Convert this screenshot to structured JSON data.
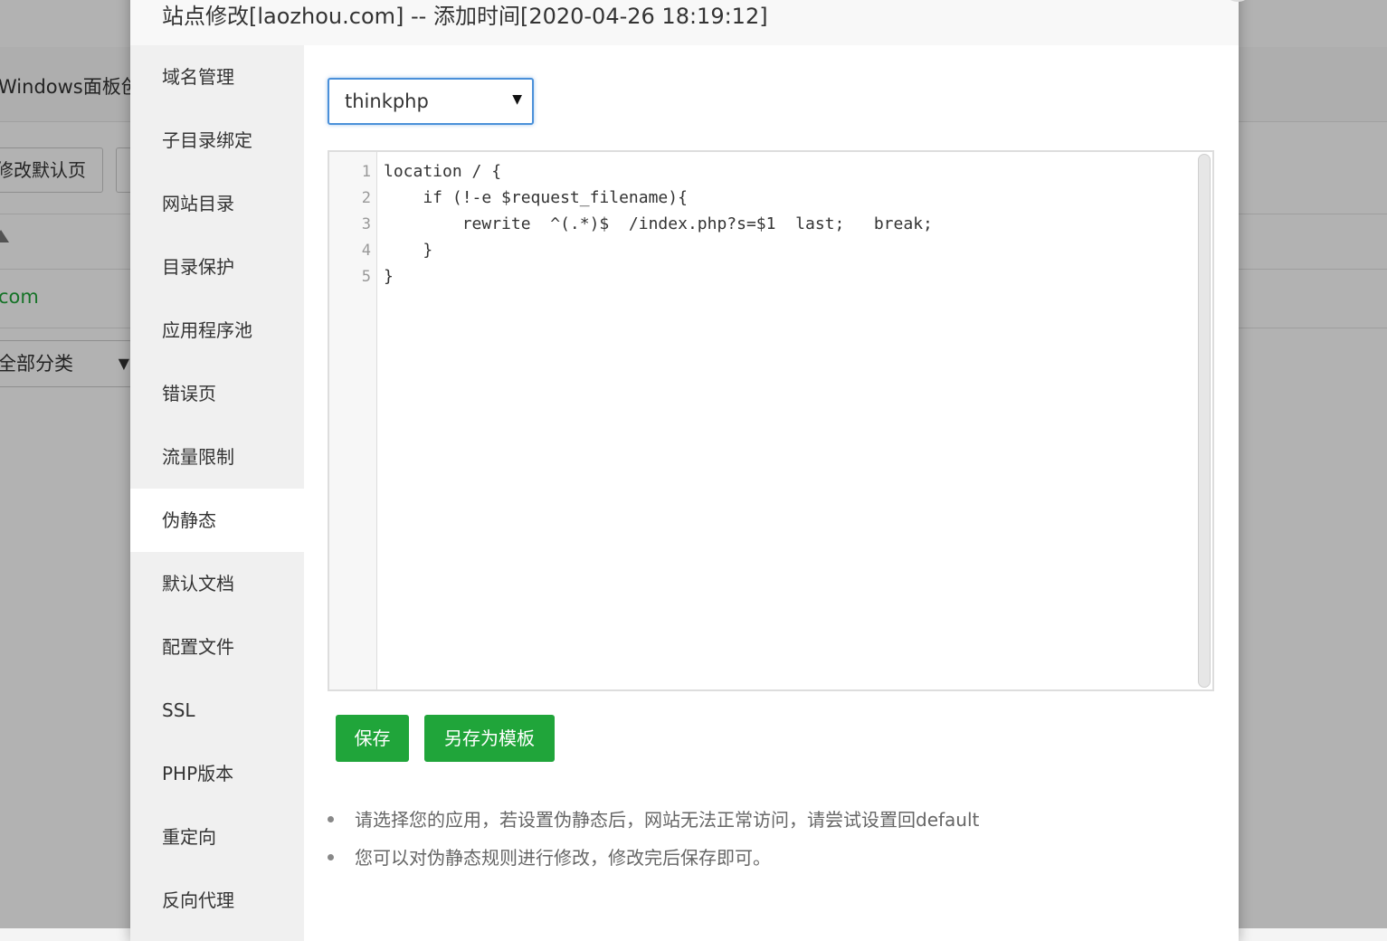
{
  "background": {
    "title_fragment": "Windows面板创",
    "button_fragment": "修改默认页",
    "link_fragment": "com",
    "select_fragment": "全部分类"
  },
  "modal": {
    "title": "站点修改[laozhou.com] -- 添加时间[2020-04-26 18:19:12]"
  },
  "sidebar": {
    "items": [
      {
        "label": "域名管理"
      },
      {
        "label": "子目录绑定"
      },
      {
        "label": "网站目录"
      },
      {
        "label": "目录保护"
      },
      {
        "label": "应用程序池"
      },
      {
        "label": "错误页"
      },
      {
        "label": "流量限制"
      },
      {
        "label": "伪静态"
      },
      {
        "label": "默认文档"
      },
      {
        "label": "配置文件"
      },
      {
        "label": "SSL"
      },
      {
        "label": "PHP版本"
      },
      {
        "label": "重定向"
      },
      {
        "label": "反向代理"
      }
    ],
    "active_label": "伪静态"
  },
  "rewrite": {
    "template_select": "thinkphp",
    "line_numbers": [
      "1",
      "2",
      "3",
      "4",
      "5"
    ],
    "code_lines": [
      "location / {",
      "    if (!-e $request_filename){",
      "        rewrite  ^(.*)$  /index.php?s=$1  last;   break;",
      "    }",
      "}"
    ],
    "save_label": "保存",
    "save_as_template_label": "另存为模板",
    "tips": [
      "请选择您的应用，若设置伪静态后，网站无法正常访问，请尝试设置回default",
      "您可以对伪静态规则进行修改，修改完后保存即可。"
    ]
  },
  "colors": {
    "primary_green": "#20a53a",
    "focus_blue": "#4a90d9"
  },
  "icons": {
    "select_arrow": "caret-down-icon",
    "close": "close-icon"
  }
}
